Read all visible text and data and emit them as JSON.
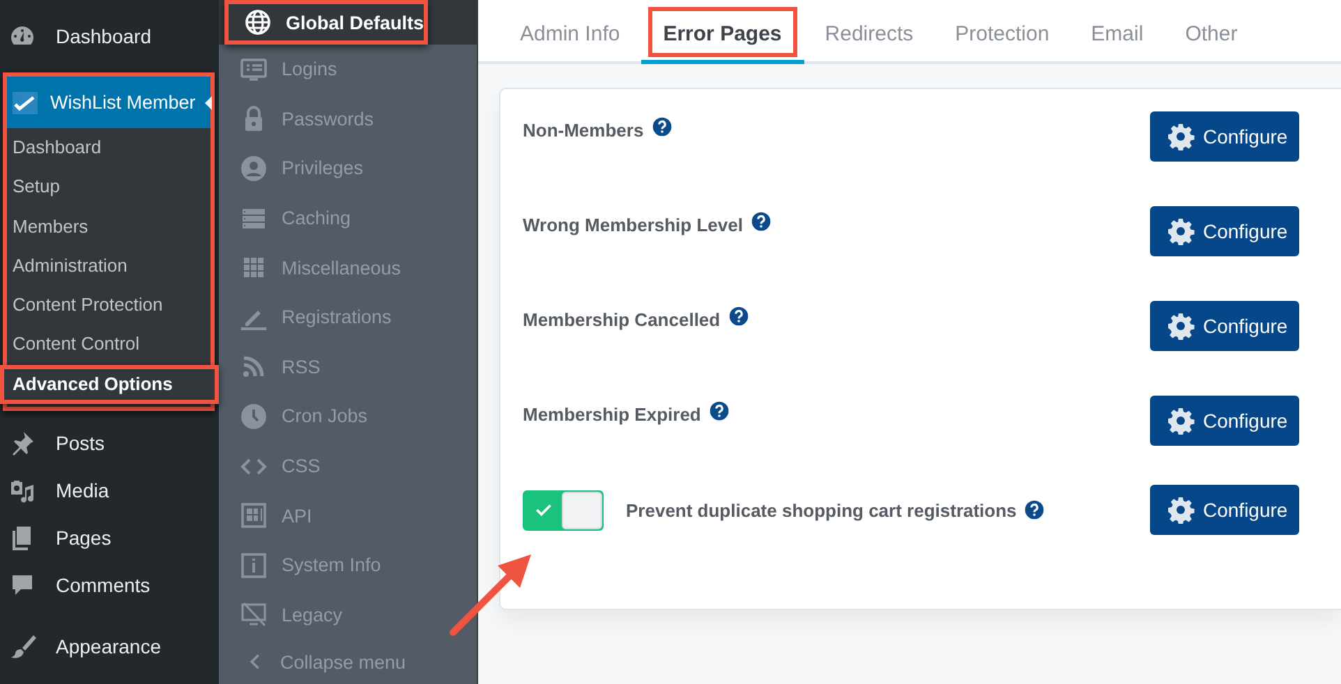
{
  "admin_menu": {
    "top_items": [
      {
        "label": "Dashboard"
      }
    ],
    "current": {
      "label": "WishList Member",
      "annotated": true,
      "submenu": [
        {
          "label": "Dashboard",
          "selected": false,
          "annotated": false
        },
        {
          "label": "Setup",
          "selected": false,
          "annotated": false
        },
        {
          "label": "Members",
          "selected": false,
          "annotated": false
        },
        {
          "label": "Administration",
          "selected": false,
          "annotated": false
        },
        {
          "label": "Content Protection",
          "selected": false,
          "annotated": false
        },
        {
          "label": "Content Control",
          "selected": false,
          "annotated": false
        },
        {
          "label": "Advanced Options",
          "selected": true,
          "annotated": true
        }
      ]
    },
    "bottom_items": [
      {
        "label": "Posts"
      },
      {
        "label": "Media"
      },
      {
        "label": "Pages"
      },
      {
        "label": "Comments"
      },
      {
        "label": "Appearance"
      }
    ]
  },
  "settings_nav": {
    "items": [
      {
        "label": "Global Defaults",
        "selected": true,
        "annotated": true
      },
      {
        "label": "Logins",
        "selected": false,
        "annotated": false
      },
      {
        "label": "Passwords",
        "selected": false,
        "annotated": false
      },
      {
        "label": "Privileges",
        "selected": false,
        "annotated": false
      },
      {
        "label": "Caching",
        "selected": false,
        "annotated": false
      },
      {
        "label": "Miscellaneous",
        "selected": false,
        "annotated": false
      },
      {
        "label": "Registrations",
        "selected": false,
        "annotated": false
      },
      {
        "label": "RSS",
        "selected": false,
        "annotated": false
      },
      {
        "label": "Cron Jobs",
        "selected": false,
        "annotated": false
      },
      {
        "label": "CSS",
        "selected": false,
        "annotated": false
      },
      {
        "label": "API",
        "selected": false,
        "annotated": false
      },
      {
        "label": "System Info",
        "selected": false,
        "annotated": false
      },
      {
        "label": "Legacy",
        "selected": false,
        "annotated": false
      }
    ],
    "collapse": {
      "label": "Collapse menu"
    }
  },
  "tabs": [
    {
      "label": "Admin Info",
      "selected": false,
      "annotated": false
    },
    {
      "label": "Error Pages",
      "selected": true,
      "annotated": true
    },
    {
      "label": "Redirects",
      "selected": false,
      "annotated": false
    },
    {
      "label": "Protection",
      "selected": false,
      "annotated": false
    },
    {
      "label": "Email",
      "selected": false,
      "annotated": false
    },
    {
      "label": "Other",
      "selected": false,
      "annotated": false
    }
  ],
  "settings": [
    {
      "kind": "plain",
      "label": "Non-Members",
      "button": "Configure"
    },
    {
      "kind": "plain",
      "label": "Wrong Membership Level",
      "button": "Configure"
    },
    {
      "kind": "plain",
      "label": "Membership Cancelled",
      "button": "Configure"
    },
    {
      "kind": "plain",
      "label": "Membership Expired",
      "button": "Configure"
    },
    {
      "kind": "toggle",
      "label": "Prevent duplicate shopping cart registrations",
      "on": true,
      "button": "Configure"
    }
  ],
  "annotation_arrow": {
    "shown": true
  }
}
